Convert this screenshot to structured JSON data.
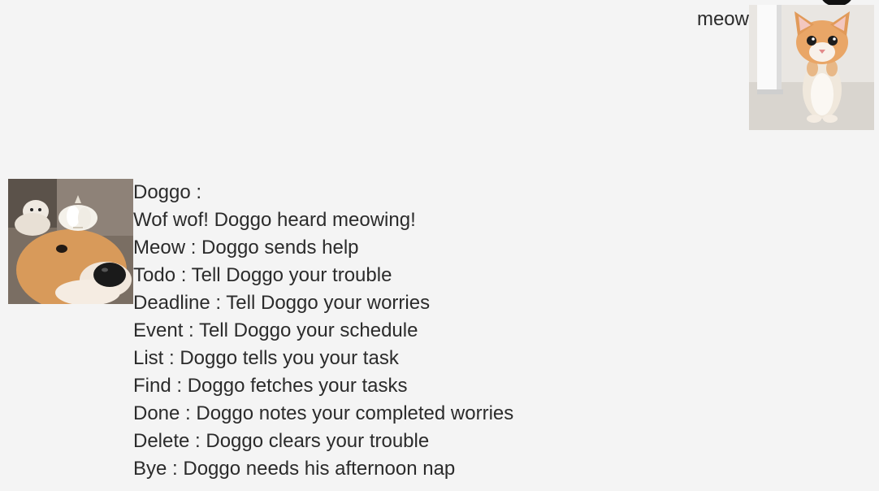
{
  "user_message": {
    "sender_icon": "cat-avatar",
    "text": "meow"
  },
  "bot_message": {
    "sender_icon": "dog-avatar",
    "lines": [
      "Doggo :",
      "Wof wof! Doggo heard meowing!",
      "Meow : Doggo sends help",
      "Todo : Tell Doggo your trouble",
      "Deadline : Tell Doggo your worries",
      "Event : Tell Doggo your schedule",
      "List : Doggo tells you your task",
      "Find : Doggo fetches your tasks",
      "Done : Doggo notes your completed worries",
      "Delete : Doggo clears your trouble",
      "Bye : Doggo needs his afternoon nap"
    ]
  },
  "colors": {
    "background": "#f4f4f4",
    "text": "#2b2b2b"
  }
}
